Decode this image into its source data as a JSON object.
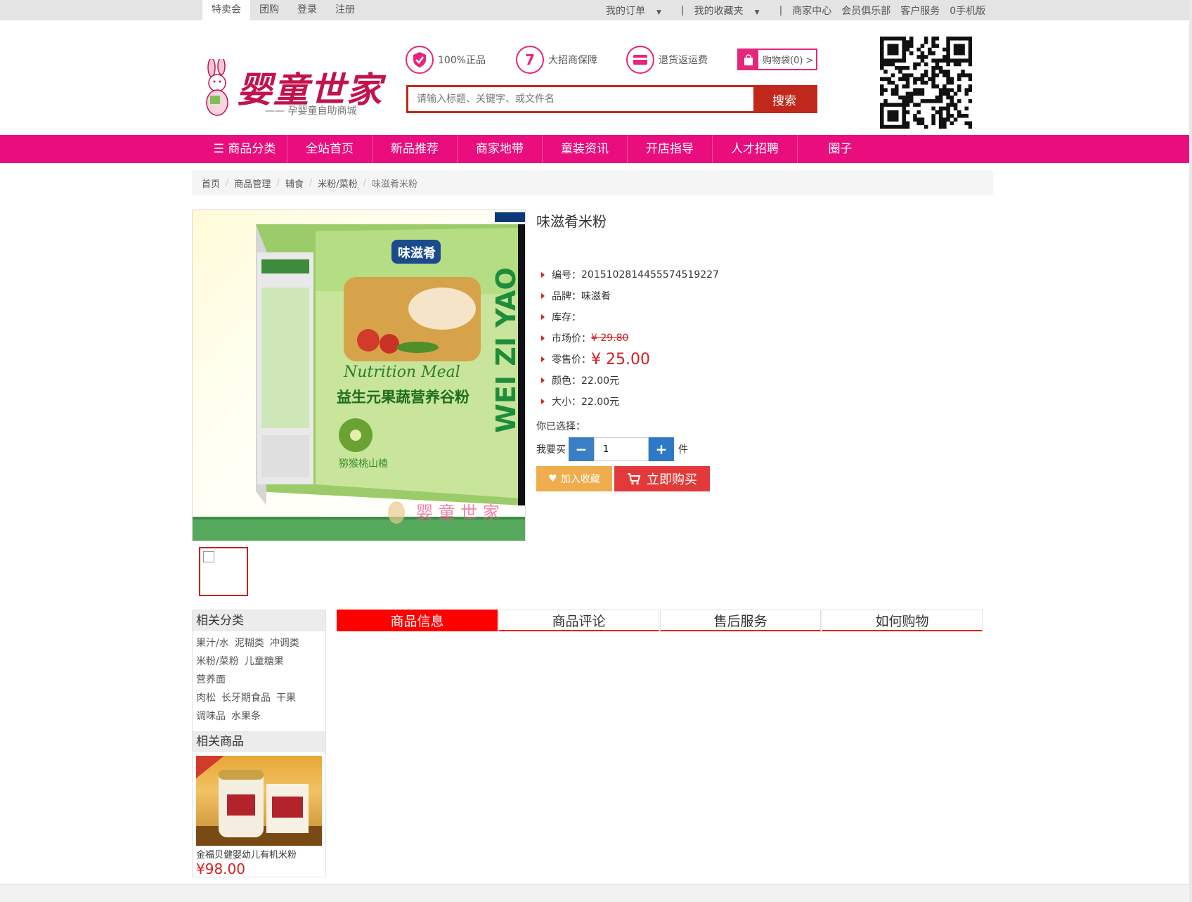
{
  "topbar": {
    "left": [
      "特卖会",
      "团购",
      "登录",
      "注册"
    ],
    "orders": "我的订单",
    "favorites": "我的收藏夹",
    "divider": "|",
    "merchant": "商家中心",
    "club": "会员俱乐部",
    "service": "客户服务",
    "mobile": "0手机版"
  },
  "logo": {
    "title": "婴童世家",
    "subtitle": "—— 孕婴童自助商城"
  },
  "guarantees": [
    {
      "icon": "shield-icon",
      "label": "100%正品"
    },
    {
      "icon": "seven-icon",
      "glyph": "7",
      "label": "大招商保障"
    },
    {
      "icon": "card-icon",
      "label": "退货返运费"
    }
  ],
  "cart": {
    "label": "购物袋(0) >"
  },
  "search": {
    "placeholder": "请输入标题、关键字、或文件名",
    "button": "搜索"
  },
  "nav": [
    "商品分类",
    "全站首页",
    "新品推荐",
    "商家地带",
    "童装资讯",
    "开店指导",
    "人才招聘",
    "圈子"
  ],
  "breadcrumb": [
    "首页",
    "商品管理",
    "辅食",
    "米粉/菜粉",
    "味滋肴米粉"
  ],
  "product": {
    "title": "味滋肴米粉",
    "box_brand": "味滋肴",
    "box_name": "益生元果蔬营养谷粉",
    "box_side": "WEI ZI YAO",
    "box_script": "Nutrition Meal",
    "box_flavor": "猕猴桃山楂",
    "watermark": "婴 童 世 家",
    "attrs": [
      {
        "label": "编号：",
        "value": "20151028144555745​19227"
      },
      {
        "label": "品牌：",
        "value": "味滋肴"
      },
      {
        "label": "库存：",
        "value": ""
      },
      {
        "label": "市场价：",
        "value": "¥ 29.80"
      },
      {
        "label": "零售价：",
        "value": "¥ 25.00"
      },
      {
        "label": "颜色：",
        "value": "22.00元"
      },
      {
        "label": "大小：",
        "value": "22.00元"
      }
    ],
    "chosen_label": "你已选择：",
    "qty_label": "我要买",
    "qty_value": "1",
    "qty_unit": "件",
    "fav_button": "加入收藏",
    "buy_button": "立即购买"
  },
  "sidebar": {
    "cat_title": "相关分类",
    "cats": [
      "果汁/水",
      "泥糊类",
      "冲调类",
      "米粉/菜粉",
      "儿童糖果",
      "营养面",
      "肉松",
      "长牙期食品",
      "干果",
      "调味品",
      "水果条"
    ],
    "rel_title": "相关商品",
    "rel_name": "金福贝健婴幼儿有机米粉",
    "rel_price": "¥98.00"
  },
  "tabs": [
    "商品信息",
    "商品评论",
    "售后服务",
    "如何购物"
  ],
  "colors": {
    "nav": "#e90d7d",
    "accent": "#c0281b",
    "price": "#d42020"
  }
}
